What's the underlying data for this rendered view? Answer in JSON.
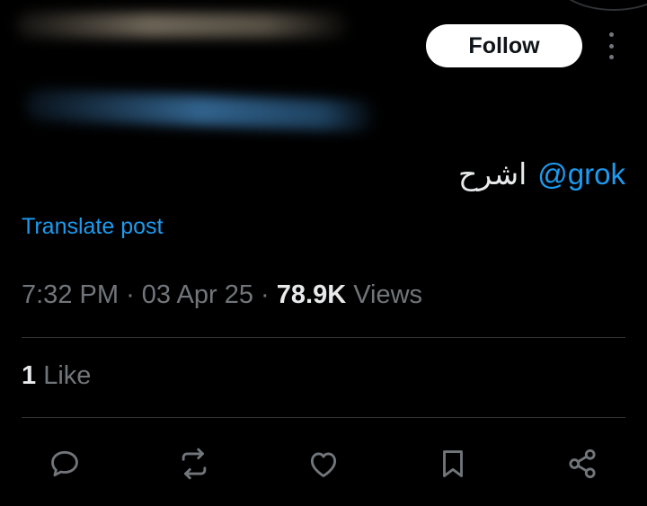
{
  "header": {
    "follow_label": "Follow"
  },
  "tweet": {
    "mention": "@grok",
    "text": "اشرح",
    "translate_label": "Translate post"
  },
  "meta": {
    "time": "7:32 PM",
    "date": "03 Apr 25",
    "views_count": "78.9K",
    "views_label": "Views",
    "separator": "·"
  },
  "engagement": {
    "likes_count": "1",
    "likes_label": "Like"
  },
  "actions": [
    {
      "icon": "reply-icon"
    },
    {
      "icon": "repost-icon"
    },
    {
      "icon": "heart-icon"
    },
    {
      "icon": "bookmark-icon"
    },
    {
      "icon": "share-icon"
    }
  ],
  "colors": {
    "background": "#000000",
    "text": "#e7e9ea",
    "secondary": "#71767b",
    "accent": "#1d9bf0",
    "divider": "#2f3336"
  }
}
